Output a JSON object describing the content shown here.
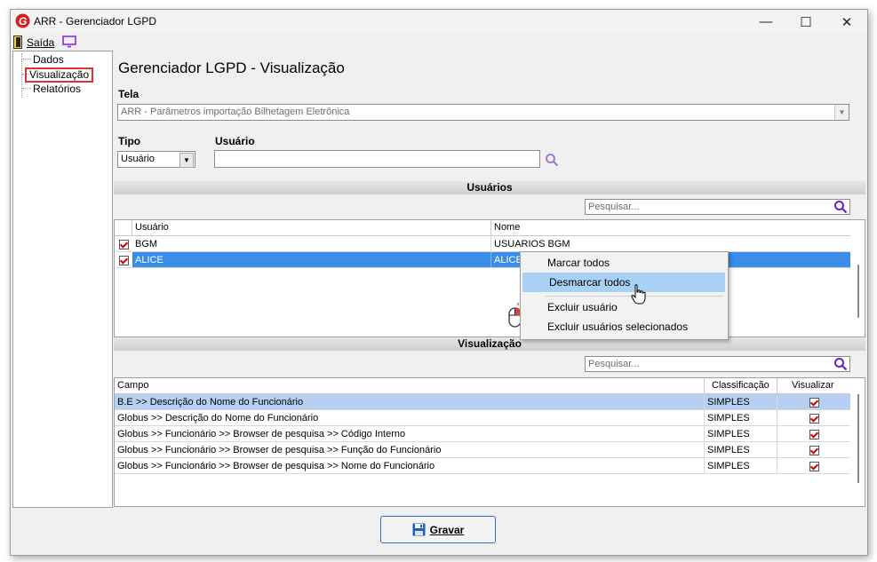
{
  "window": {
    "title": "ARR - Gerenciador LGPD",
    "minimize": "—",
    "maximize": "☐",
    "close": "✕"
  },
  "menu": {
    "exit_label": "Saída"
  },
  "tree": {
    "items": [
      "Dados",
      "Visualização",
      "Relatórios"
    ],
    "selected": "Visualização"
  },
  "page_title": "Gerenciador LGPD - Visualização",
  "tela": {
    "label": "Tela",
    "value": "ARR - Parâmetros importação Bilhetagem Eletrônica"
  },
  "tipo": {
    "label": "Tipo",
    "value": "Usuário"
  },
  "usuario_field": {
    "label": "Usuário",
    "value": ""
  },
  "users_section": {
    "title": "Usuários",
    "search_placeholder": "Pesquisar...",
    "columns": [
      "Usuário",
      "Nome"
    ],
    "rows": [
      {
        "usuario": "BGM",
        "nome": "USUARIOS BGM",
        "checked": true
      },
      {
        "usuario": "ALICE",
        "nome": "ALICE",
        "checked": true
      }
    ]
  },
  "context_menu": {
    "items": [
      "Marcar todos",
      "Desmarcar todos",
      "Excluir usuário",
      "Excluir usuários selecionados"
    ],
    "highlighted": "Desmarcar todos"
  },
  "view_section": {
    "title": "Visualização",
    "search_placeholder": "Pesquisar...",
    "columns": [
      "Campo",
      "Classificação",
      "Visualizar"
    ],
    "rows": [
      {
        "campo": "B.E >> Descrição do Nome do Funcionário",
        "classificacao": "SIMPLES",
        "visualizar": true
      },
      {
        "campo": "Globus >> Descrição do Nome do Funcionário",
        "classificacao": "SIMPLES",
        "visualizar": true
      },
      {
        "campo": "Globus >> Funcionário >> Browser de pesquisa >> Código Interno",
        "classificacao": "SIMPLES",
        "visualizar": true
      },
      {
        "campo": "Globus >> Funcionário >> Browser de pesquisa >> Função do Funcionário",
        "classificacao": "SIMPLES",
        "visualizar": true
      },
      {
        "campo": "Globus >> Funcionário >> Browser de pesquisa >> Nome do Funcionário",
        "classificacao": "SIMPLES",
        "visualizar": true
      }
    ]
  },
  "save_button": {
    "label": "Gravar"
  },
  "colors": {
    "selection": "#3b8ee8",
    "menu_highlight": "#a9d1f5",
    "row_highlight": "#b7cff2",
    "accent_purple": "#8a2be2",
    "tree_highlight_border": "#e03030"
  }
}
